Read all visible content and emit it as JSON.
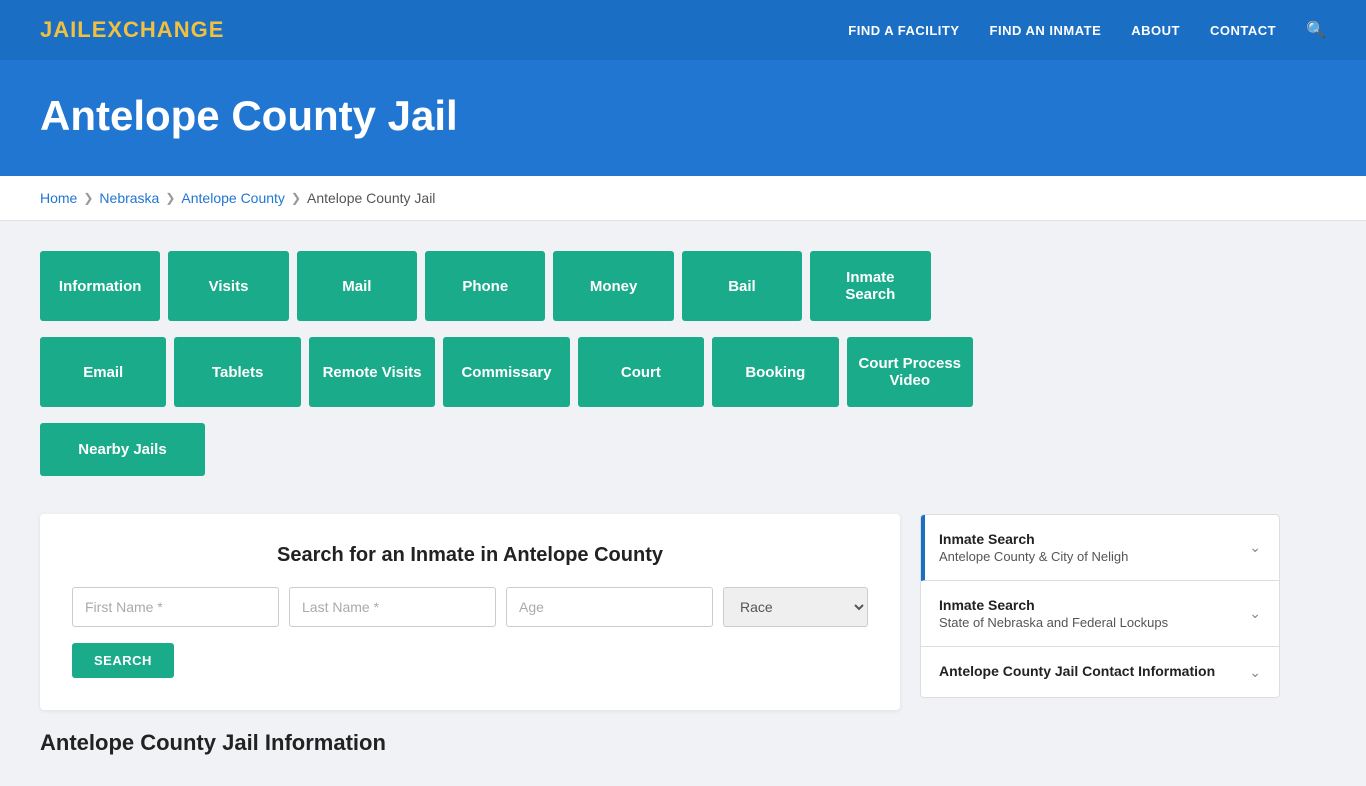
{
  "header": {
    "logo_jail": "JAIL",
    "logo_exchange": "EXCHANGE",
    "nav_items": [
      "FIND A FACILITY",
      "FIND AN INMATE",
      "ABOUT",
      "CONTACT"
    ]
  },
  "hero": {
    "title": "Antelope County Jail"
  },
  "breadcrumb": {
    "items": [
      "Home",
      "Nebraska",
      "Antelope County",
      "Antelope County Jail"
    ]
  },
  "button_grid": {
    "row1": [
      "Information",
      "Visits",
      "Mail",
      "Phone",
      "Money",
      "Bail",
      "Inmate Search"
    ],
    "row2": [
      "Email",
      "Tablets",
      "Remote Visits",
      "Commissary",
      "Court",
      "Booking",
      "Court Process Video"
    ],
    "row3": [
      "Nearby Jails"
    ]
  },
  "search_section": {
    "title": "Search for an Inmate in Antelope County",
    "first_name_placeholder": "First Name *",
    "last_name_placeholder": "Last Name *",
    "age_placeholder": "Age",
    "race_placeholder": "Race",
    "search_button": "SEARCH"
  },
  "sidebar_cards": [
    {
      "title": "Inmate Search",
      "subtitle": "Antelope County & City of Neligh",
      "active": true
    },
    {
      "title": "Inmate Search",
      "subtitle": "State of Nebraska and Federal Lockups",
      "active": false
    },
    {
      "title": "Antelope County Jail Contact Information",
      "subtitle": "",
      "active": false
    }
  ],
  "bottom_section": {
    "title": "Antelope County Jail Information"
  }
}
